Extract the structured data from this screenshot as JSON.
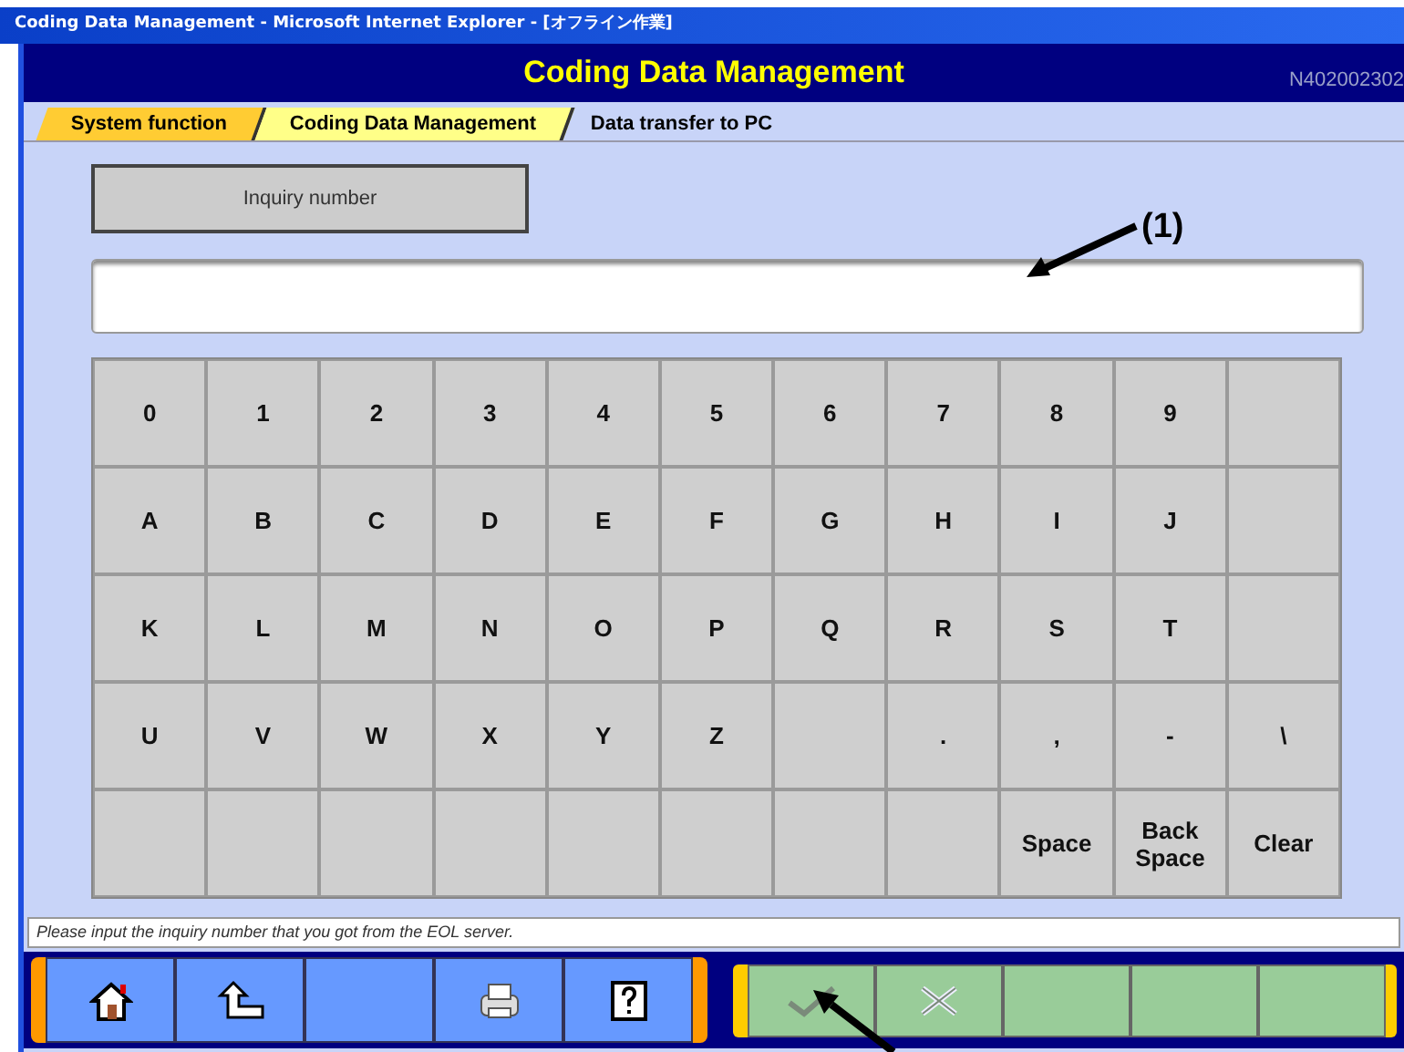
{
  "window": {
    "title": "Coding Data Management - Microsoft Internet Explorer - [オフライン作業]"
  },
  "header": {
    "title": "Coding Data Management",
    "screen_id": "N402002302"
  },
  "breadcrumb": [
    {
      "label": "System function",
      "selected": false
    },
    {
      "label": "Coding Data Management",
      "selected": false
    },
    {
      "label": "Data transfer to PC",
      "selected": true
    }
  ],
  "inquiry_button": {
    "label": "Inquiry number"
  },
  "annotations": [
    {
      "label": "(1)"
    }
  ],
  "keypad": [
    [
      {
        "kind": "key",
        "label": "0"
      },
      {
        "kind": "key",
        "label": "1"
      },
      {
        "kind": "key",
        "label": "2"
      },
      {
        "kind": "key",
        "label": "3"
      },
      {
        "kind": "key",
        "label": "4"
      },
      {
        "kind": "key",
        "label": "5"
      },
      {
        "kind": "key",
        "label": "6"
      },
      {
        "kind": "key",
        "label": "7"
      },
      {
        "kind": "key",
        "label": "8"
      },
      {
        "kind": "key",
        "label": "9"
      },
      {
        "kind": "blank"
      }
    ],
    [
      {
        "kind": "key",
        "label": "A"
      },
      {
        "kind": "key",
        "label": "B"
      },
      {
        "kind": "key",
        "label": "C"
      },
      {
        "kind": "key",
        "label": "D"
      },
      {
        "kind": "key",
        "label": "E"
      },
      {
        "kind": "key",
        "label": "F"
      },
      {
        "kind": "key",
        "label": "G"
      },
      {
        "kind": "key",
        "label": "H"
      },
      {
        "kind": "key",
        "label": "I"
      },
      {
        "kind": "key",
        "label": "J"
      },
      {
        "kind": "blank"
      }
    ],
    [
      {
        "kind": "key",
        "label": "K"
      },
      {
        "kind": "key",
        "label": "L"
      },
      {
        "kind": "key",
        "label": "M"
      },
      {
        "kind": "key",
        "label": "N"
      },
      {
        "kind": "key",
        "label": "O"
      },
      {
        "kind": "key",
        "label": "P"
      },
      {
        "kind": "key",
        "label": "Q"
      },
      {
        "kind": "key",
        "label": "R"
      },
      {
        "kind": "key",
        "label": "S"
      },
      {
        "kind": "key",
        "label": "T"
      },
      {
        "kind": "blank"
      }
    ],
    [
      {
        "kind": "key",
        "label": "U"
      },
      {
        "kind": "key",
        "label": "V"
      },
      {
        "kind": "key",
        "label": "W"
      },
      {
        "kind": "key",
        "label": "X"
      },
      {
        "kind": "key",
        "label": "Y"
      },
      {
        "kind": "key",
        "label": "Z"
      },
      {
        "kind": "blank"
      },
      {
        "kind": "key",
        "label": "."
      },
      {
        "kind": "key",
        "label": ","
      },
      {
        "kind": "key",
        "label": "-"
      },
      {
        "kind": "key",
        "label": "\\"
      }
    ],
    [
      {
        "kind": "blank"
      },
      {
        "kind": "blank"
      },
      {
        "kind": "blank"
      },
      {
        "kind": "blank"
      },
      {
        "kind": "blank"
      },
      {
        "kind": "blank"
      },
      {
        "kind": "blank"
      },
      {
        "kind": "blank"
      },
      {
        "kind": "key",
        "label": "Space"
      },
      {
        "kind": "key",
        "label": "Back Space"
      },
      {
        "kind": "key",
        "label": "Clear"
      }
    ]
  ],
  "status_message": "Please input the inquiry number that you got from the EOL server.",
  "left_toolbar": [
    {
      "kind": "home"
    },
    {
      "kind": "back"
    },
    {
      "kind": "blank"
    },
    {
      "kind": "print"
    },
    {
      "kind": "help"
    }
  ],
  "right_toolbar": [
    {
      "kind": "ok",
      "disabled": true
    },
    {
      "kind": "cancel",
      "disabled": true
    },
    {
      "kind": "blank",
      "disabled": true
    },
    {
      "kind": "blank",
      "disabled": true
    },
    {
      "kind": "blank",
      "disabled": true
    }
  ]
}
